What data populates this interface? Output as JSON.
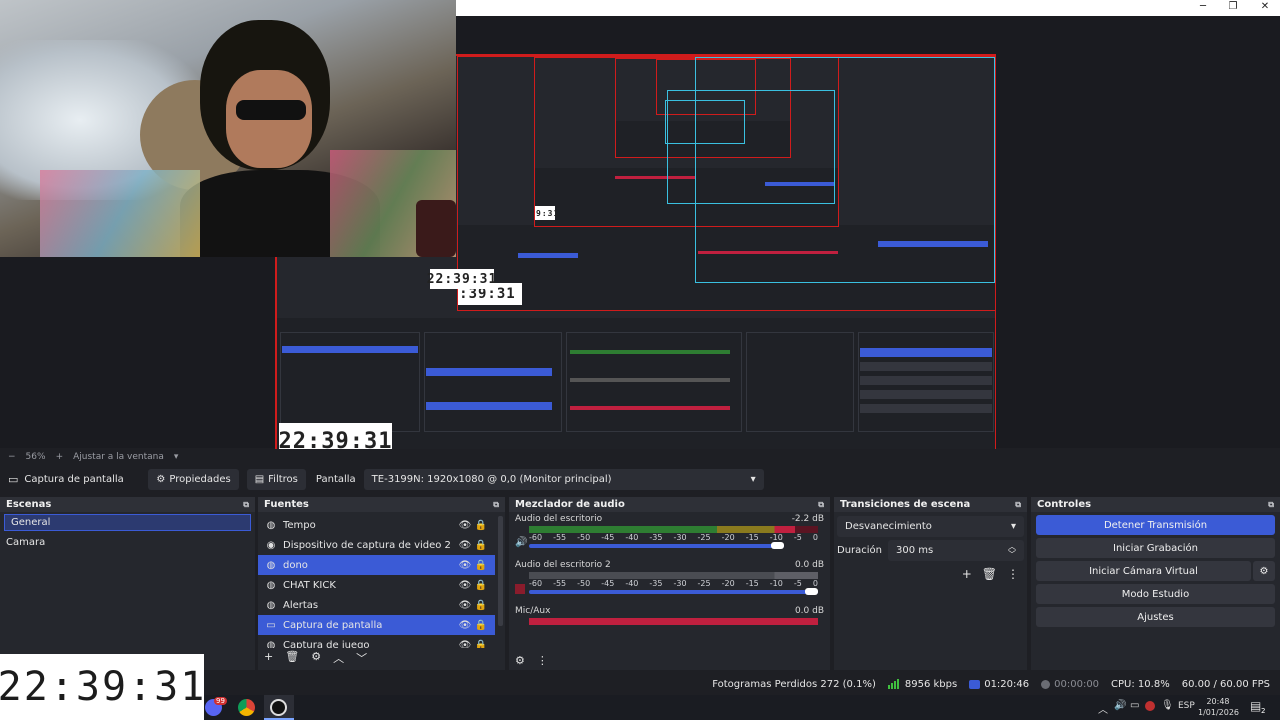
{
  "window": {
    "minimize": "─",
    "maximize": "❐",
    "close": "✕"
  },
  "clocks": {
    "value": "22:39:31"
  },
  "zoom": {
    "level": "56%",
    "fit_label": "Ajustar a la ventana"
  },
  "source_toolbar": {
    "source_name": "Captura de pantalla",
    "properties_label": "Propiedades",
    "filters_label": "Filtros",
    "display_label": "Pantalla",
    "display_value": "TE-3199N: 1920x1080 @ 0,0 (Monitor principal)"
  },
  "scenes": {
    "title": "Escenas",
    "items": [
      "General",
      "Camara"
    ]
  },
  "sources": {
    "title": "Fuentes",
    "items": [
      {
        "label": "Tempo",
        "icon": "globe-icon"
      },
      {
        "label": "Dispositivo de captura de video 2",
        "icon": "camera-icon"
      },
      {
        "label": "dono",
        "icon": "globe-icon"
      },
      {
        "label": "CHAT KICK",
        "icon": "globe-icon"
      },
      {
        "label": "Alertas",
        "icon": "globe-icon"
      },
      {
        "label": "Captura de pantalla",
        "icon": "monitor-icon"
      },
      {
        "label": "Captura de juego",
        "icon": "gamepad-icon"
      }
    ]
  },
  "mixer": {
    "title": "Mezclador de audio",
    "ticks": [
      "-60",
      "-55",
      "-50",
      "-45",
      "-40",
      "-35",
      "-30",
      "-25",
      "-20",
      "-15",
      "-10",
      "-5",
      "0"
    ],
    "channels": [
      {
        "name": "Audio del escritorio",
        "db": "-2.2 dB",
        "level": 0.92,
        "fader": 0.97
      },
      {
        "name": "Audio del escritorio 2",
        "db": "0.0 dB",
        "level": 0.0,
        "fader": 1.0
      },
      {
        "name": "Mic/Aux",
        "db": "0.0 dB",
        "level": 0.0,
        "fader": 1.0
      }
    ]
  },
  "transitions": {
    "title": "Transiciones de escena",
    "selected": "Desvanecimiento",
    "duration_label": "Duración",
    "duration_value": "300 ms"
  },
  "controls": {
    "title": "Controles",
    "buttons": [
      "Detener Transmisión",
      "Iniciar Grabación",
      "Iniciar Cámara Virtual",
      "Modo Estudio",
      "Ajustes"
    ]
  },
  "status": {
    "dropped": "Fotogramas Perdidos 272 (0.1%)",
    "bitrate": "8956 kbps",
    "stream_time": "01:20:46",
    "rec_time": "00:00:00",
    "cpu": "CPU: 10.8%",
    "fps": "60.00 / 60.00 FPS"
  },
  "taskbar": {
    "lang": "ESP",
    "time": "20:48",
    "date": "1/01/2026",
    "notif_count": "2",
    "badge": "99"
  },
  "colors": {
    "accent": "#3b5bd6",
    "red_border": "#d01c1c",
    "cyan_box": "#3ac0e0",
    "meter_green": "#2e7d32",
    "meter_yellow": "#8a7a1e",
    "meter_red": "#c0203f"
  }
}
